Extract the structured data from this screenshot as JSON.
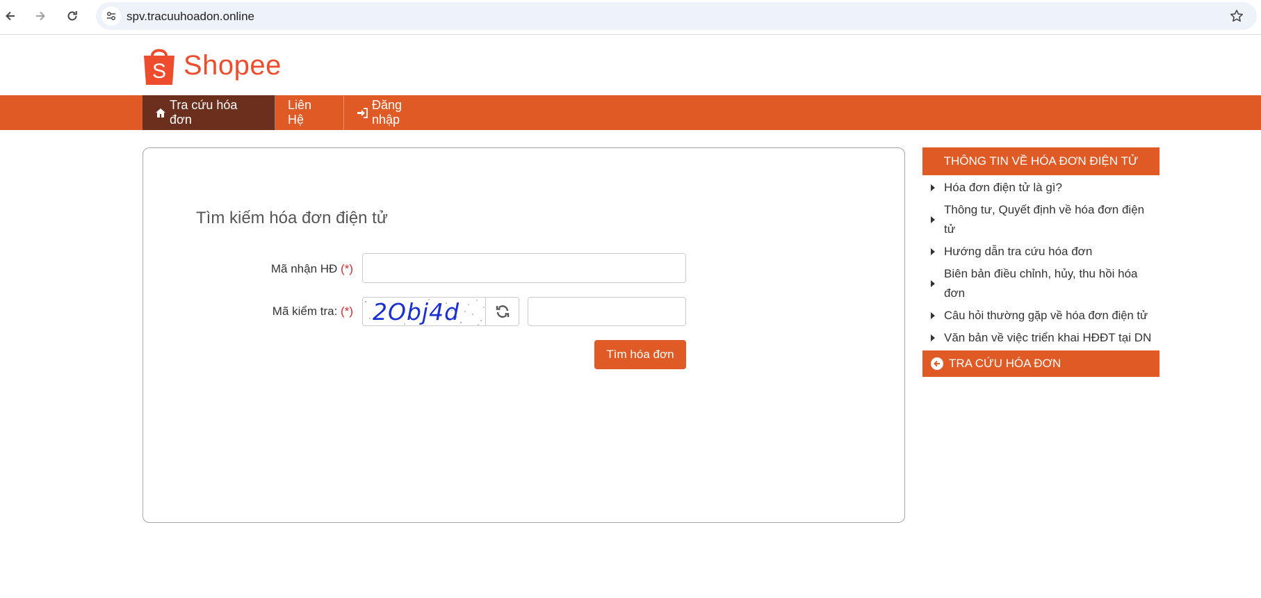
{
  "browser": {
    "url": "spv.tracuuhoadon.online",
    "back_icon": "arrow-left-icon",
    "forward_icon": "arrow-right-icon",
    "reload_icon": "reload-icon",
    "site_info_icon": "tune-icon",
    "bookmark_icon": "star-icon"
  },
  "logo": {
    "text": "Shopee",
    "icon": "shopping-bag-icon",
    "color": "#ee4d2d"
  },
  "nav": {
    "color": "#e05a25",
    "active_color": "#6b2f1d",
    "items": [
      {
        "label": "Tra cứu hóa đơn",
        "icon": "home-icon"
      },
      {
        "label": "Liên Hệ"
      },
      {
        "label": "Đăng nhập",
        "icon": "sign-in-icon"
      }
    ]
  },
  "form": {
    "title": "Tìm kiếm hóa đơn điện tử",
    "receive_code_label": "Mã nhận HĐ",
    "check_code_label": "Mã kiểm tra:",
    "required_mark": "(*)",
    "receive_code_value": "",
    "check_code_value": "",
    "captcha": "2Obj4d",
    "refresh_icon": "refresh-icon",
    "submit_label": "Tìm hóa đơn"
  },
  "sidebar": {
    "header": "THÔNG TIN VỀ HÓA ĐƠN ĐIỆN TỬ",
    "items": [
      {
        "label": "Hóa đơn điện tử là gì?"
      },
      {
        "label": "Thông tư, Quyết định về hóa đơn điện tử"
      },
      {
        "label": "Hướng dẫn tra cứu hóa đơn"
      },
      {
        "label": "Biên bản điều chỉnh, hủy, thu hồi hóa đơn"
      },
      {
        "label": "Câu hỏi thường gặp về hóa đơn điện tử"
      },
      {
        "label": "Văn bản về việc triển khai HĐĐT tại DN"
      }
    ],
    "footer": "TRA CỨU HÓA ĐƠN",
    "footer_icon": "circle-arrow-left-icon"
  }
}
